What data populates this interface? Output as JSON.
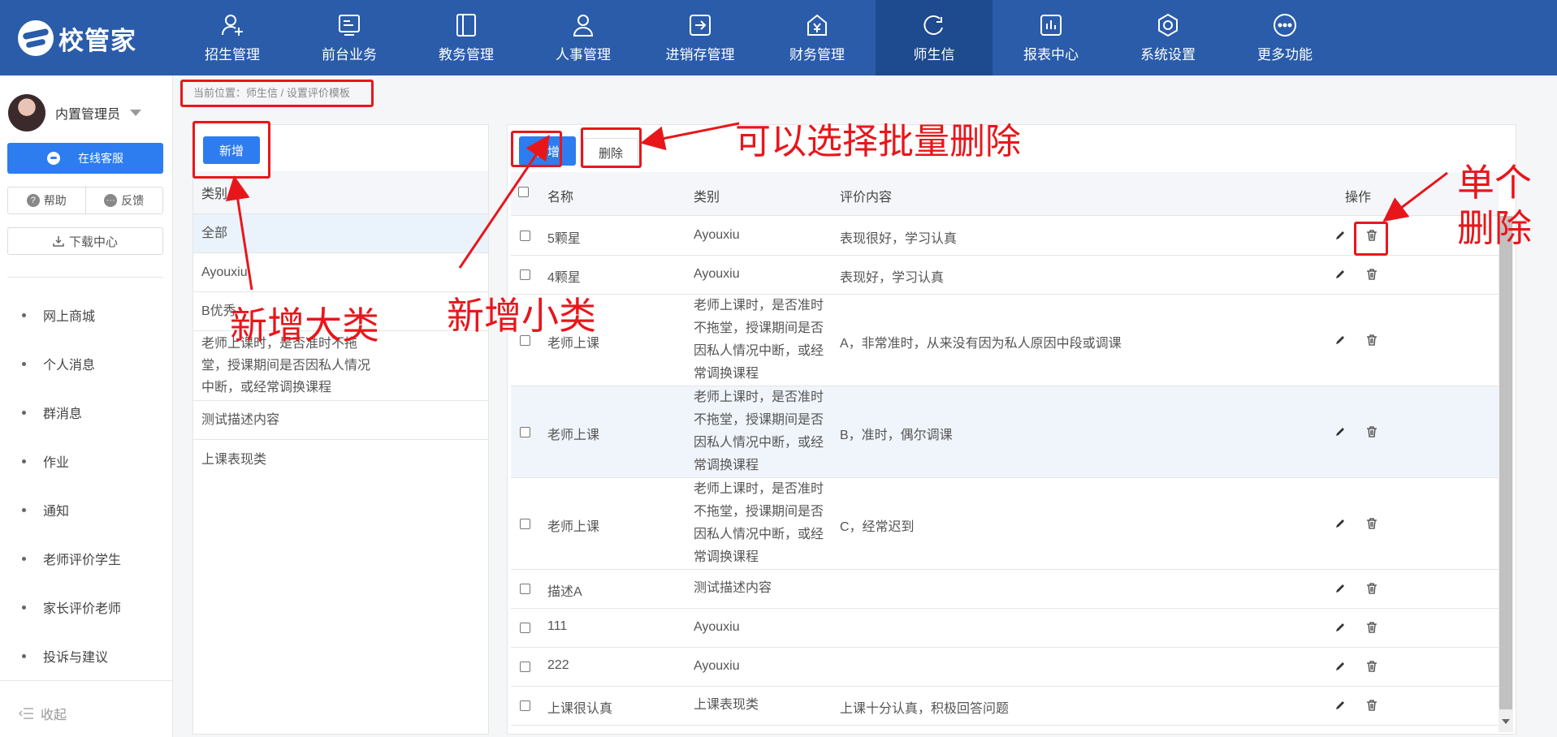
{
  "app": {
    "logo_text": "校管家"
  },
  "nav": [
    {
      "label": "招生管理",
      "icon": "person-add-icon"
    },
    {
      "label": "前台业务",
      "icon": "monitor-icon"
    },
    {
      "label": "教务管理",
      "icon": "book-icon"
    },
    {
      "label": "人事管理",
      "icon": "person-icon"
    },
    {
      "label": "进销存管理",
      "icon": "arrow-box-icon"
    },
    {
      "label": "财务管理",
      "icon": "yen-icon"
    },
    {
      "label": "师生信",
      "icon": "chat-icon",
      "active": true
    },
    {
      "label": "报表中心",
      "icon": "bar-chart-icon"
    },
    {
      "label": "系统设置",
      "icon": "gear-icon"
    },
    {
      "label": "更多功能",
      "icon": "more-icon"
    }
  ],
  "sidebar": {
    "user_name": "内置管理员",
    "service_label": "在线客服",
    "help_label": "帮助",
    "feedback_label": "反馈",
    "download_label": "下载中心",
    "menu": [
      "网上商城",
      "个人消息",
      "群消息",
      "作业",
      "通知",
      "老师评价学生",
      "家长评价老师",
      "投诉与建议"
    ],
    "collapse_label": "收起"
  },
  "breadcrumb": "当前位置：师生信 / 设置评价模板",
  "categories": {
    "add_label": "新增",
    "header": "类别",
    "items": [
      "全部",
      "Ayouxiu",
      "B优秀",
      "老师上课时，是否准时不拖堂，授课期间是否因私人情况中断，或经常调换课程",
      "测试描述内容",
      "上课表现类"
    ]
  },
  "table": {
    "add_label": "新增",
    "delete_label": "删除",
    "columns": {
      "name": "名称",
      "type": "类别",
      "content": "评价内容",
      "ops": "操作"
    },
    "rows": [
      {
        "name": "5颗星",
        "type": "Ayouxiu",
        "content": "表现很好，学习认真"
      },
      {
        "name": "4颗星",
        "type": "Ayouxiu",
        "content": "表现好，学习认真"
      },
      {
        "name": "老师上课",
        "type": "老师上课时，是否准时不拖堂，授课期间是否因私人情况中断，或经常调换课程",
        "content": "A，非常准时，从来没有因为私人原因中段或调课"
      },
      {
        "name": "老师上课",
        "type": "老师上课时，是否准时不拖堂，授课期间是否因私人情况中断，或经常调换课程",
        "content": "B，准时，偶尔调课"
      },
      {
        "name": "老师上课",
        "type": "老师上课时，是否准时不拖堂，授课期间是否因私人情况中断，或经常调换课程",
        "content": "C，经常迟到"
      },
      {
        "name": "描述A",
        "type": "测试描述内容",
        "content": ""
      },
      {
        "name": "111",
        "type": "Ayouxiu",
        "content": ""
      },
      {
        "name": "222",
        "type": "Ayouxiu",
        "content": ""
      },
      {
        "name": "上课很认真",
        "type": "上课表现类",
        "content": "上课十分认真，积极回答问题"
      }
    ]
  },
  "annotations": {
    "batch_delete": "可以选择批量删除",
    "single_delete": "单个删除",
    "add_category": "新增大类",
    "add_subcategory": "新增小类"
  },
  "colors": {
    "nav_bg": "#2a5caa",
    "primary": "#2d7cf0",
    "annotation": "#e8161b"
  }
}
